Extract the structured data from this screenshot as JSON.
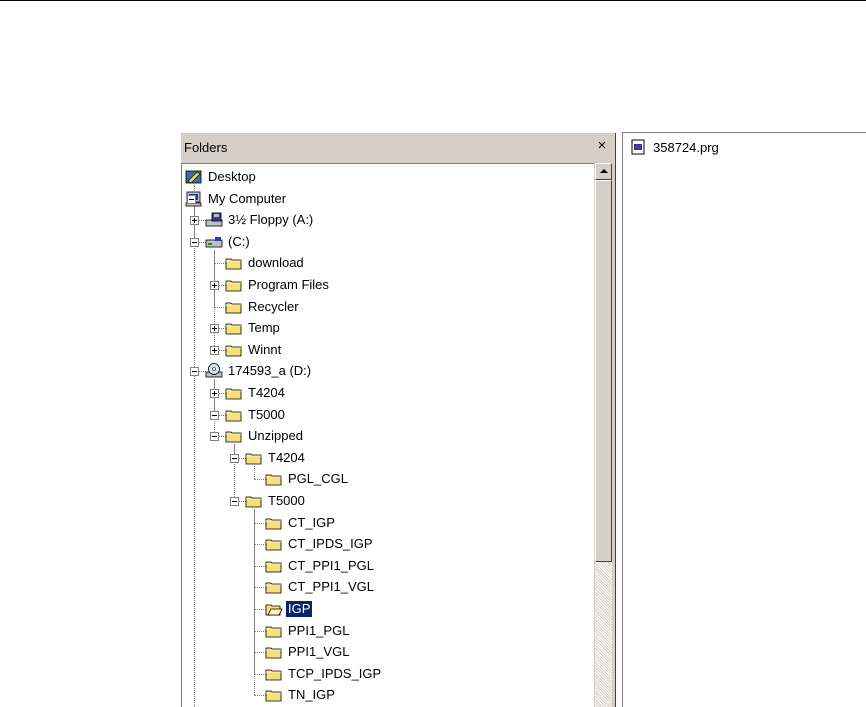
{
  "folders_pane": {
    "title": "Folders",
    "close_glyph": "×"
  },
  "tree": [
    {
      "label": "Desktop",
      "icon": "desktop-icon"
    },
    {
      "label": "My Computer",
      "icon": "computer-icon"
    },
    {
      "label": "3½ Floppy (A:)",
      "icon": "floppy-drive-icon"
    },
    {
      "label": "(C:)",
      "icon": "hard-drive-icon"
    },
    {
      "label": "download",
      "icon": "folder-icon"
    },
    {
      "label": "Program Files",
      "icon": "folder-icon"
    },
    {
      "label": "Recycler",
      "icon": "folder-icon"
    },
    {
      "label": "Temp",
      "icon": "folder-icon"
    },
    {
      "label": "Winnt",
      "icon": "folder-icon"
    },
    {
      "label": "174593_a (D:)",
      "icon": "cd-drive-icon"
    },
    {
      "label": "T4204",
      "icon": "folder-icon"
    },
    {
      "label": "T5000",
      "icon": "folder-icon"
    },
    {
      "label": "Unzipped",
      "icon": "folder-icon"
    },
    {
      "label": "T4204",
      "icon": "folder-icon"
    },
    {
      "label": "PGL_CGL",
      "icon": "folder-icon"
    },
    {
      "label": "T5000",
      "icon": "folder-icon"
    },
    {
      "label": "CT_IGP",
      "icon": "folder-icon"
    },
    {
      "label": "CT_IPDS_IGP",
      "icon": "folder-icon"
    },
    {
      "label": "CT_PPI1_PGL",
      "icon": "folder-icon"
    },
    {
      "label": "CT_PPI1_VGL",
      "icon": "folder-icon"
    },
    {
      "label": "IGP",
      "icon": "open-folder-icon",
      "selected": true
    },
    {
      "label": "PPI1_PGL",
      "icon": "folder-icon"
    },
    {
      "label": "PPI1_VGL",
      "icon": "folder-icon"
    },
    {
      "label": "TCP_IPDS_IGP",
      "icon": "folder-icon"
    },
    {
      "label": "TN_IGP",
      "icon": "folder-icon"
    }
  ],
  "file_pane": {
    "items": [
      {
        "label": "358724.prg",
        "icon": "program-file-icon"
      }
    ]
  },
  "colors": {
    "selection": "#0a246a",
    "folder": "#f5e07a",
    "chrome": "#d4d0c8"
  }
}
